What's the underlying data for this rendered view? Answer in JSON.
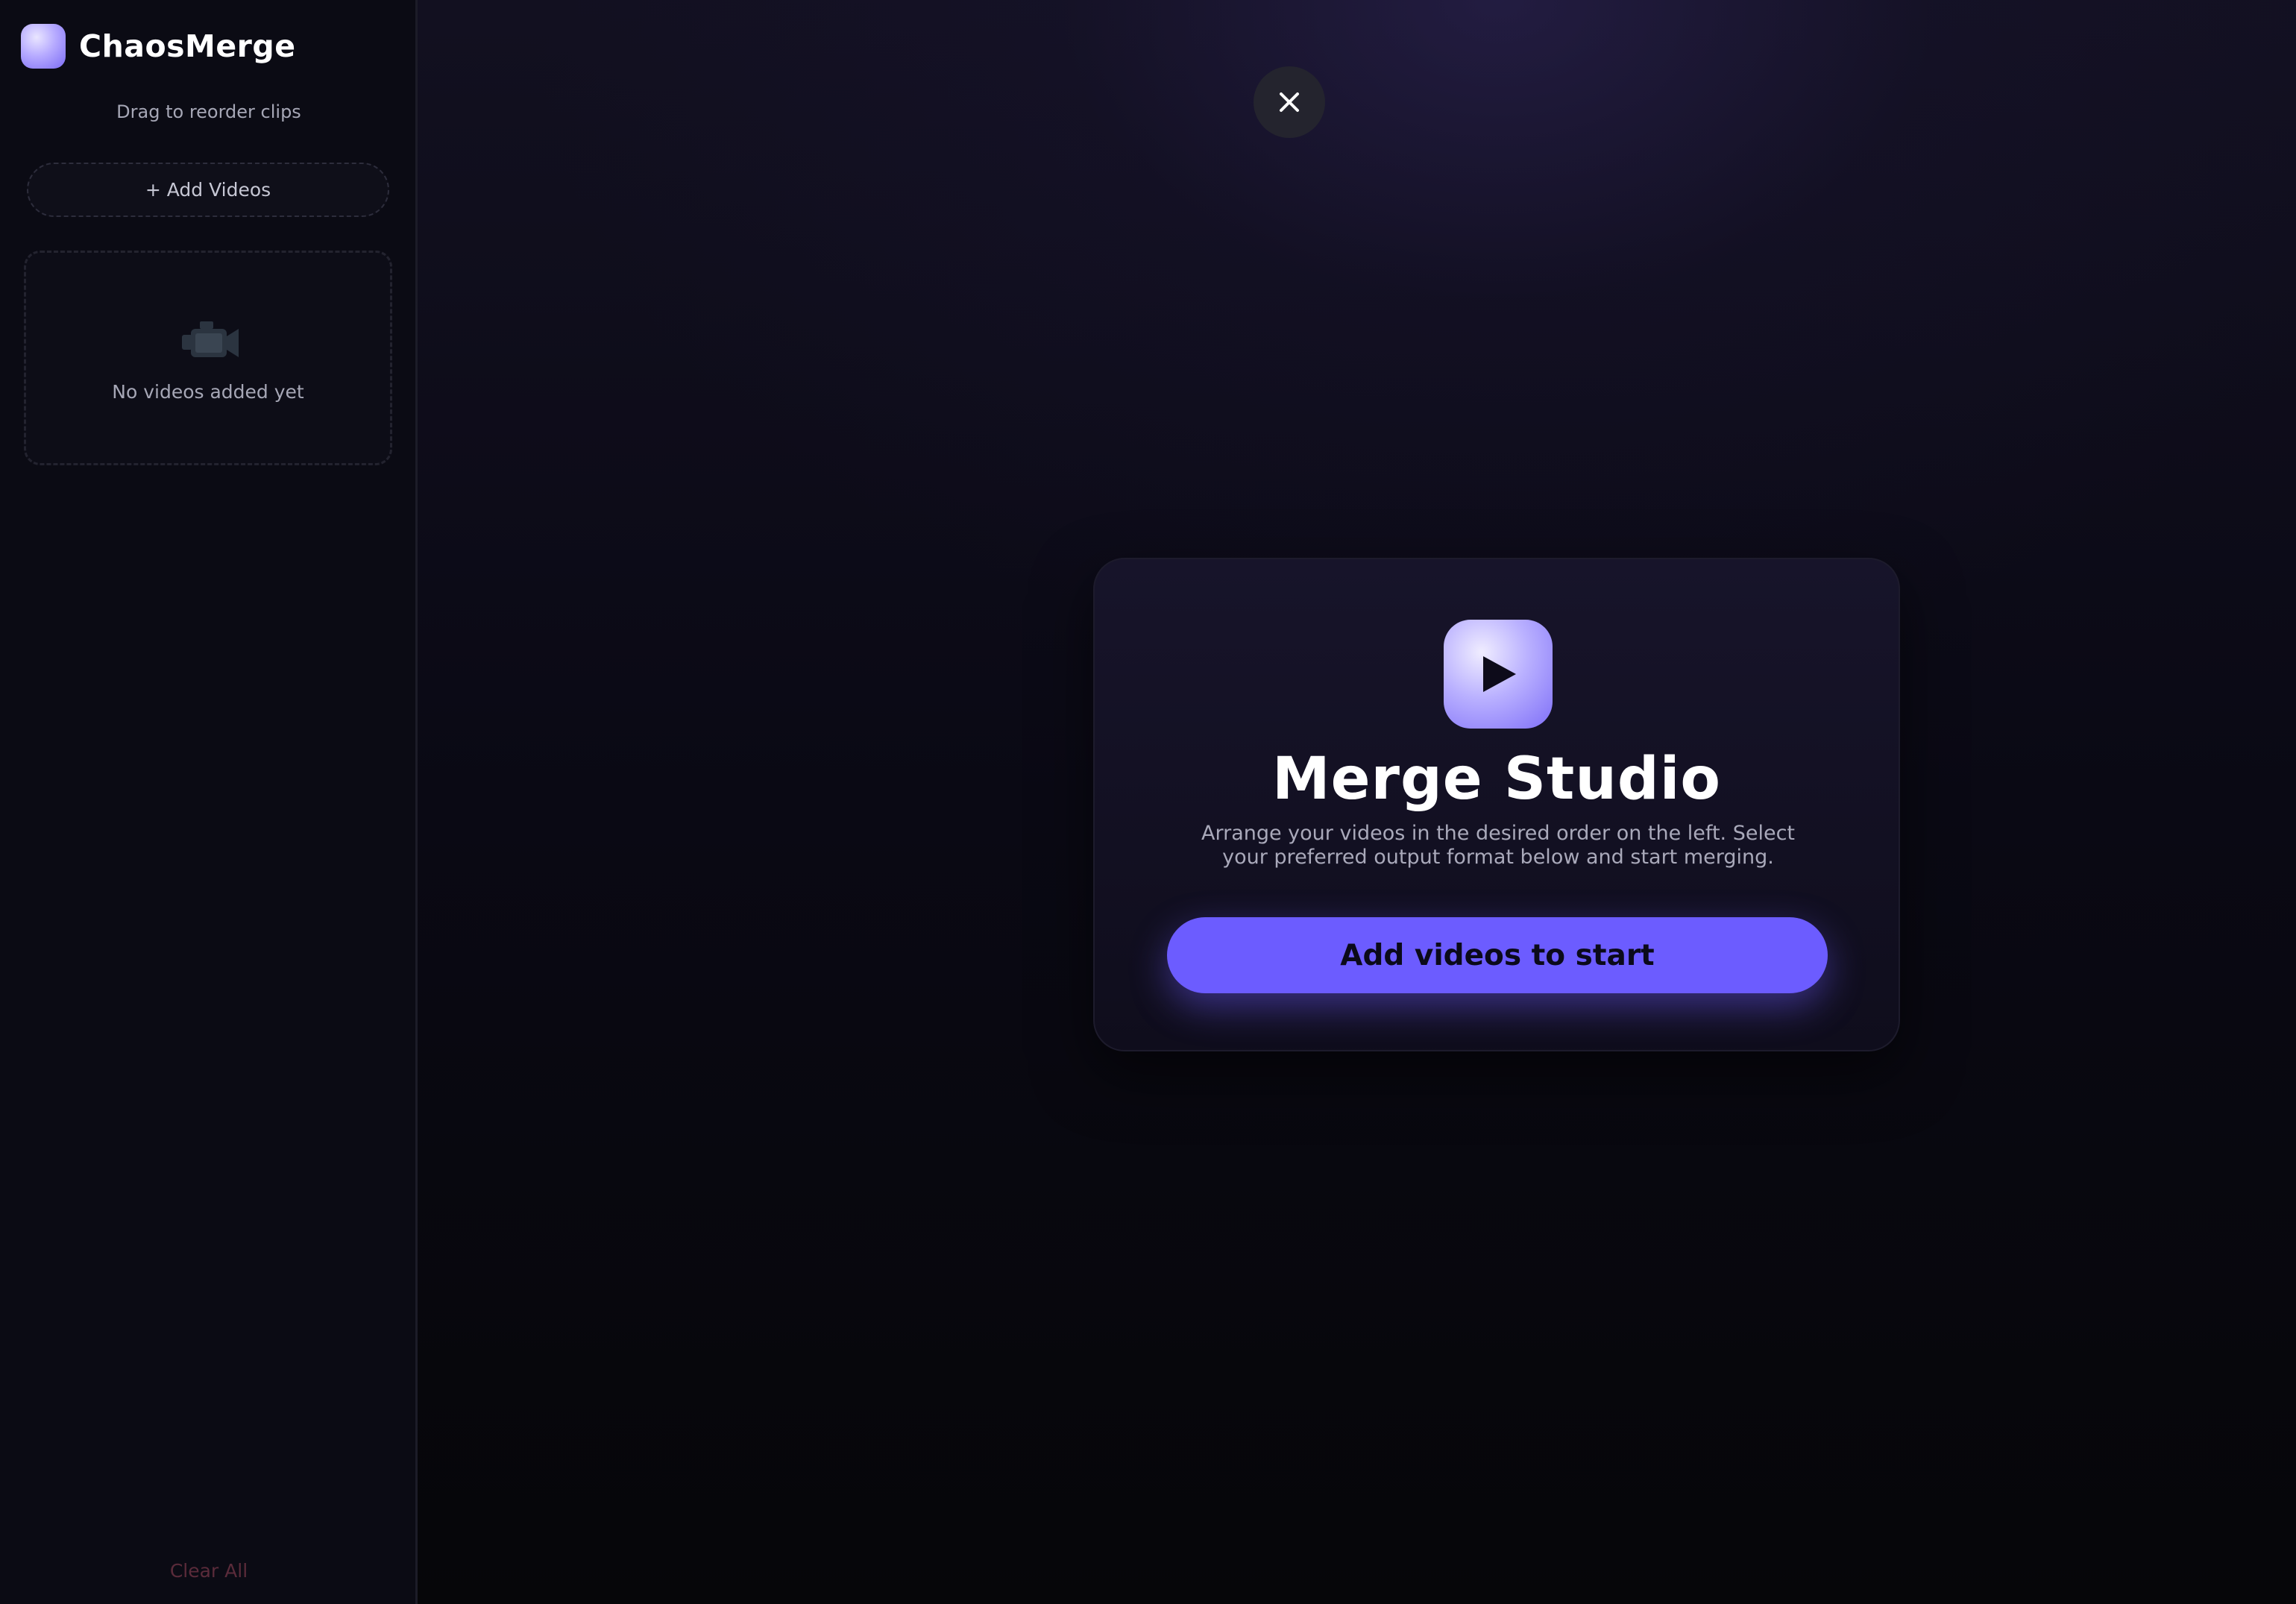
{
  "app": {
    "name": "ChaosMerge"
  },
  "sidebar": {
    "hint": "Drag to reorder clips",
    "add_videos_label": "+ Add Videos",
    "empty_state": {
      "icon": "video-camera-icon",
      "text": "No videos added yet"
    },
    "clear_all_label": "Clear All"
  },
  "main": {
    "close_icon": "close-icon",
    "card": {
      "icon": "play-icon",
      "title": "Merge Studio",
      "description": "Arrange your videos in the desired order on the left. Select your preferred output format below and start merging.",
      "start_button_label": "Add videos to start"
    }
  },
  "colors": {
    "accent": "#6c5cff",
    "background": "#08080f",
    "sidebar": "#0b0b14",
    "danger_text": "#5a2b3a"
  }
}
